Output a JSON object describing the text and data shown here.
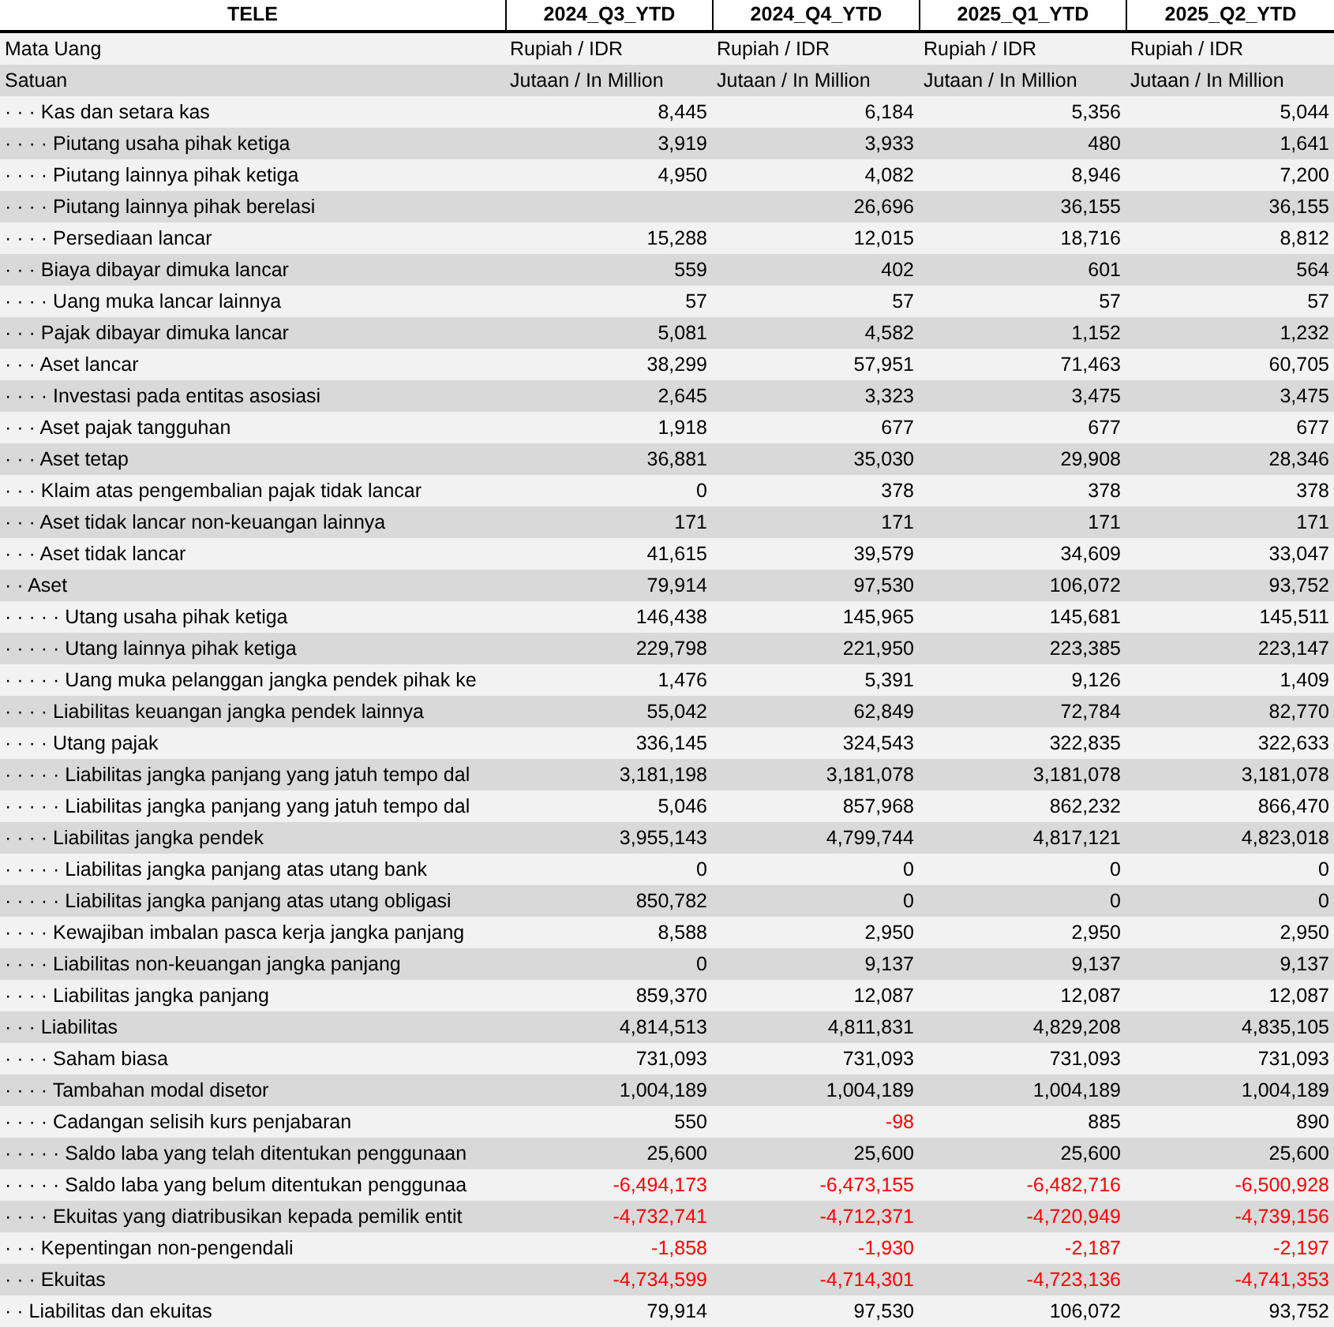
{
  "table": {
    "columns": [
      "TELE",
      "2024_Q3_YTD",
      "2024_Q4_YTD",
      "2025_Q1_YTD",
      "2025_Q2_YTD"
    ],
    "meta_rows": [
      {
        "label": "Mata Uang",
        "values": [
          "Rupiah / IDR",
          "Rupiah / IDR",
          "Rupiah / IDR",
          "Rupiah / IDR"
        ]
      },
      {
        "label": "Satuan",
        "values": [
          "Jutaan / In Million",
          "Jutaan / In Million",
          "Jutaan / In Million",
          "Jutaan / In Million"
        ]
      }
    ],
    "rows": [
      {
        "label": "· · · Kas dan setara kas",
        "cells": [
          {
            "text": "8,445",
            "negative": false
          },
          {
            "text": "6,184",
            "negative": false
          },
          {
            "text": "5,356",
            "negative": false
          },
          {
            "text": "5,044",
            "negative": false
          }
        ]
      },
      {
        "label": "· · · · Piutang usaha pihak ketiga",
        "cells": [
          {
            "text": "3,919",
            "negative": false
          },
          {
            "text": "3,933",
            "negative": false
          },
          {
            "text": "480",
            "negative": false
          },
          {
            "text": "1,641",
            "negative": false
          }
        ]
      },
      {
        "label": "· · · · Piutang lainnya pihak ketiga",
        "cells": [
          {
            "text": "4,950",
            "negative": false
          },
          {
            "text": "4,082",
            "negative": false
          },
          {
            "text": "8,946",
            "negative": false
          },
          {
            "text": "7,200",
            "negative": false
          }
        ]
      },
      {
        "label": "· · · · Piutang lainnya pihak berelasi",
        "cells": [
          {},
          {
            "text": "26,696",
            "negative": false
          },
          {
            "text": "36,155",
            "negative": false
          },
          {
            "text": "36,155",
            "negative": false
          }
        ]
      },
      {
        "label": "· · · · Persediaan lancar",
        "cells": [
          {
            "text": "15,288",
            "negative": false
          },
          {
            "text": "12,015",
            "negative": false
          },
          {
            "text": "18,716",
            "negative": false
          },
          {
            "text": "8,812",
            "negative": false
          }
        ]
      },
      {
        "label": "· · · Biaya dibayar dimuka lancar",
        "cells": [
          {
            "text": "559",
            "negative": false
          },
          {
            "text": "402",
            "negative": false
          },
          {
            "text": "601",
            "negative": false
          },
          {
            "text": "564",
            "negative": false
          }
        ]
      },
      {
        "label": "· · · · Uang muka lancar lainnya",
        "cells": [
          {
            "text": "57",
            "negative": false
          },
          {
            "text": "57",
            "negative": false
          },
          {
            "text": "57",
            "negative": false
          },
          {
            "text": "57",
            "negative": false
          }
        ]
      },
      {
        "label": "· · · Pajak dibayar dimuka lancar",
        "cells": [
          {
            "text": "5,081",
            "negative": false
          },
          {
            "text": "4,582",
            "negative": false
          },
          {
            "text": "1,152",
            "negative": false
          },
          {
            "text": "1,232",
            "negative": false
          }
        ]
      },
      {
        "label": "· · · Aset lancar",
        "cells": [
          {
            "text": "38,299",
            "negative": false
          },
          {
            "text": "57,951",
            "negative": false
          },
          {
            "text": "71,463",
            "negative": false
          },
          {
            "text": "60,705",
            "negative": false
          }
        ]
      },
      {
        "label": "· · · · Investasi pada entitas asosiasi",
        "cells": [
          {
            "text": "2,645",
            "negative": false
          },
          {
            "text": "3,323",
            "negative": false
          },
          {
            "text": "3,475",
            "negative": false
          },
          {
            "text": "3,475",
            "negative": false
          }
        ]
      },
      {
        "label": "· · · Aset pajak tangguhan",
        "cells": [
          {
            "text": "1,918",
            "negative": false
          },
          {
            "text": "677",
            "negative": false
          },
          {
            "text": "677",
            "negative": false
          },
          {
            "text": "677",
            "negative": false
          }
        ]
      },
      {
        "label": "· · · Aset tetap",
        "cells": [
          {
            "text": "36,881",
            "negative": false
          },
          {
            "text": "35,030",
            "negative": false
          },
          {
            "text": "29,908",
            "negative": false
          },
          {
            "text": "28,346",
            "negative": false
          }
        ]
      },
      {
        "label": "· · · Klaim atas pengembalian pajak tidak lancar",
        "cells": [
          {
            "text": "0",
            "negative": false
          },
          {
            "text": "378",
            "negative": false
          },
          {
            "text": "378",
            "negative": false
          },
          {
            "text": "378",
            "negative": false
          }
        ]
      },
      {
        "label": "· · · Aset tidak lancar non-keuangan lainnya",
        "cells": [
          {
            "text": "171",
            "negative": false
          },
          {
            "text": "171",
            "negative": false
          },
          {
            "text": "171",
            "negative": false
          },
          {
            "text": "171",
            "negative": false
          }
        ]
      },
      {
        "label": "· · · Aset tidak lancar",
        "cells": [
          {
            "text": "41,615",
            "negative": false
          },
          {
            "text": "39,579",
            "negative": false
          },
          {
            "text": "34,609",
            "negative": false
          },
          {
            "text": "33,047",
            "negative": false
          }
        ]
      },
      {
        "label": "· · Aset",
        "cells": [
          {
            "text": "79,914",
            "negative": false
          },
          {
            "text": "97,530",
            "negative": false
          },
          {
            "text": "106,072",
            "negative": false
          },
          {
            "text": "93,752",
            "negative": false
          }
        ]
      },
      {
        "label": "· · · · · Utang usaha pihak ketiga",
        "cells": [
          {
            "text": "146,438",
            "negative": false
          },
          {
            "text": "145,965",
            "negative": false
          },
          {
            "text": "145,681",
            "negative": false
          },
          {
            "text": "145,511",
            "negative": false
          }
        ]
      },
      {
        "label": "· · · · · Utang lainnya pihak ketiga",
        "cells": [
          {
            "text": "229,798",
            "negative": false
          },
          {
            "text": "221,950",
            "negative": false
          },
          {
            "text": "223,385",
            "negative": false
          },
          {
            "text": "223,147",
            "negative": false
          }
        ]
      },
      {
        "label": "· · · · · Uang muka pelanggan jangka pendek pihak ke",
        "cells": [
          {
            "text": "1,476",
            "negative": false
          },
          {
            "text": "5,391",
            "negative": false
          },
          {
            "text": "9,126",
            "negative": false
          },
          {
            "text": "1,409",
            "negative": false
          }
        ]
      },
      {
        "label": "· · · · Liabilitas keuangan jangka pendek lainnya",
        "cells": [
          {
            "text": "55,042",
            "negative": false
          },
          {
            "text": "62,849",
            "negative": false
          },
          {
            "text": "72,784",
            "negative": false
          },
          {
            "text": "82,770",
            "negative": false
          }
        ]
      },
      {
        "label": "· · · · Utang pajak",
        "cells": [
          {
            "text": "336,145",
            "negative": false
          },
          {
            "text": "324,543",
            "negative": false
          },
          {
            "text": "322,835",
            "negative": false
          },
          {
            "text": "322,633",
            "negative": false
          }
        ]
      },
      {
        "label": "· · · · · Liabilitas jangka panjang yang jatuh tempo dal",
        "cells": [
          {
            "text": "3,181,198",
            "negative": false
          },
          {
            "text": "3,181,078",
            "negative": false
          },
          {
            "text": "3,181,078",
            "negative": false
          },
          {
            "text": "3,181,078",
            "negative": false
          }
        ]
      },
      {
        "label": "· · · · · Liabilitas jangka panjang yang jatuh tempo dal",
        "cells": [
          {
            "text": "5,046",
            "negative": false
          },
          {
            "text": "857,968",
            "negative": false
          },
          {
            "text": "862,232",
            "negative": false
          },
          {
            "text": "866,470",
            "negative": false
          }
        ]
      },
      {
        "label": "· · · · Liabilitas jangka pendek",
        "cells": [
          {
            "text": "3,955,143",
            "negative": false
          },
          {
            "text": "4,799,744",
            "negative": false
          },
          {
            "text": "4,817,121",
            "negative": false
          },
          {
            "text": "4,823,018",
            "negative": false
          }
        ]
      },
      {
        "label": "· · · · · Liabilitas jangka panjang atas utang bank",
        "cells": [
          {
            "text": "0",
            "negative": false
          },
          {
            "text": "0",
            "negative": false
          },
          {
            "text": "0",
            "negative": false
          },
          {
            "text": "0",
            "negative": false
          }
        ]
      },
      {
        "label": "· · · · · Liabilitas jangka panjang atas utang obligasi",
        "cells": [
          {
            "text": "850,782",
            "negative": false
          },
          {
            "text": "0",
            "negative": false
          },
          {
            "text": "0",
            "negative": false
          },
          {
            "text": "0",
            "negative": false
          }
        ]
      },
      {
        "label": "· · · · Kewajiban imbalan pasca kerja jangka panjang",
        "cells": [
          {
            "text": "8,588",
            "negative": false
          },
          {
            "text": "2,950",
            "negative": false
          },
          {
            "text": "2,950",
            "negative": false
          },
          {
            "text": "2,950",
            "negative": false
          }
        ]
      },
      {
        "label": "· · · · Liabilitas non-keuangan jangka panjang",
        "cells": [
          {
            "text": "0",
            "negative": false
          },
          {
            "text": "9,137",
            "negative": false
          },
          {
            "text": "9,137",
            "negative": false
          },
          {
            "text": "9,137",
            "negative": false
          }
        ]
      },
      {
        "label": "· · · · Liabilitas jangka panjang",
        "cells": [
          {
            "text": "859,370",
            "negative": false
          },
          {
            "text": "12,087",
            "negative": false
          },
          {
            "text": "12,087",
            "negative": false
          },
          {
            "text": "12,087",
            "negative": false
          }
        ]
      },
      {
        "label": "· · · Liabilitas",
        "cells": [
          {
            "text": "4,814,513",
            "negative": false
          },
          {
            "text": "4,811,831",
            "negative": false
          },
          {
            "text": "4,829,208",
            "negative": false
          },
          {
            "text": "4,835,105",
            "negative": false
          }
        ]
      },
      {
        "label": "· · · · Saham biasa",
        "cells": [
          {
            "text": "731,093",
            "negative": false
          },
          {
            "text": "731,093",
            "negative": false
          },
          {
            "text": "731,093",
            "negative": false
          },
          {
            "text": "731,093",
            "negative": false
          }
        ]
      },
      {
        "label": "· · · · Tambahan modal disetor",
        "cells": [
          {
            "text": "1,004,189",
            "negative": false
          },
          {
            "text": "1,004,189",
            "negative": false
          },
          {
            "text": "1,004,189",
            "negative": false
          },
          {
            "text": "1,004,189",
            "negative": false
          }
        ]
      },
      {
        "label": "· · · · Cadangan selisih kurs penjabaran",
        "cells": [
          {
            "text": "550",
            "negative": false
          },
          {
            "text": "-98",
            "negative": true
          },
          {
            "text": "885",
            "negative": false
          },
          {
            "text": "890",
            "negative": false
          }
        ]
      },
      {
        "label": "· · · · · Saldo laba yang telah ditentukan penggunaan",
        "cells": [
          {
            "text": "25,600",
            "negative": false
          },
          {
            "text": "25,600",
            "negative": false
          },
          {
            "text": "25,600",
            "negative": false
          },
          {
            "text": "25,600",
            "negative": false
          }
        ]
      },
      {
        "label": "· · · · · Saldo laba yang belum ditentukan penggunaa",
        "cells": [
          {
            "text": "-6,494,173",
            "negative": true
          },
          {
            "text": "-6,473,155",
            "negative": true
          },
          {
            "text": "-6,482,716",
            "negative": true
          },
          {
            "text": "-6,500,928",
            "negative": true
          }
        ]
      },
      {
        "label": "· · · · Ekuitas yang diatribusikan kepada pemilik entit",
        "cells": [
          {
            "text": "-4,732,741",
            "negative": true
          },
          {
            "text": "-4,712,371",
            "negative": true
          },
          {
            "text": "-4,720,949",
            "negative": true
          },
          {
            "text": "-4,739,156",
            "negative": true
          }
        ]
      },
      {
        "label": "· · · Kepentingan non-pengendali",
        "cells": [
          {
            "text": "-1,858",
            "negative": true
          },
          {
            "text": "-1,930",
            "negative": true
          },
          {
            "text": "-2,187",
            "negative": true
          },
          {
            "text": "-2,197",
            "negative": true
          }
        ]
      },
      {
        "label": "· · · Ekuitas",
        "cells": [
          {
            "text": "-4,734,599",
            "negative": true
          },
          {
            "text": "-4,714,301",
            "negative": true
          },
          {
            "text": "-4,723,136",
            "negative": true
          },
          {
            "text": "-4,741,353",
            "negative": true
          }
        ]
      },
      {
        "label": "· · Liabilitas dan ekuitas",
        "cells": [
          {
            "text": "79,914",
            "negative": false
          },
          {
            "text": "97,530",
            "negative": false
          },
          {
            "text": "106,072",
            "negative": false
          },
          {
            "text": "93,752",
            "negative": false
          }
        ]
      }
    ]
  }
}
